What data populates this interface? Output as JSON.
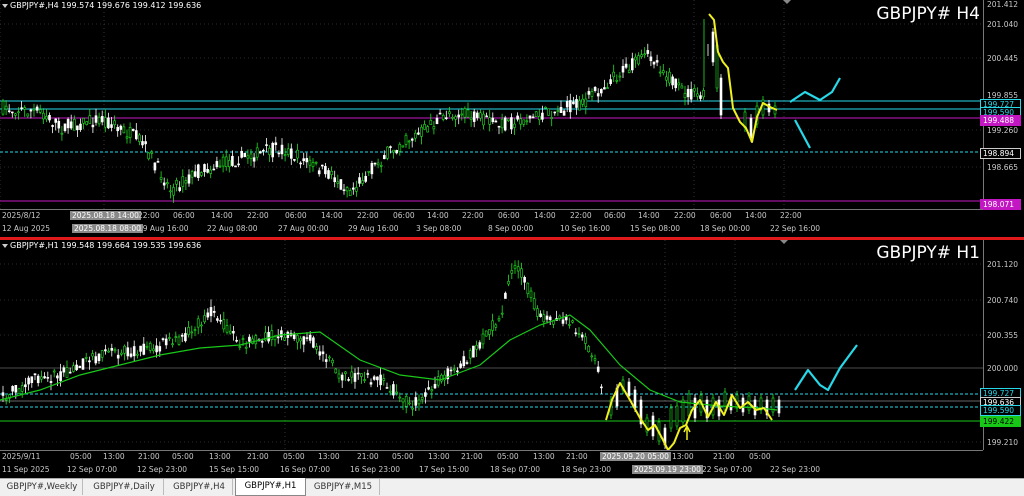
{
  "tabs": [
    {
      "label": "GBPJPY#,Weekly",
      "active": false
    },
    {
      "label": "GBPJPY#,Daily",
      "active": false
    },
    {
      "label": "GBPJPY#,H4",
      "active": false
    },
    {
      "label": "GBPJPY#,H1",
      "active": true
    },
    {
      "label": "GBPJPY#,M15",
      "active": false
    }
  ],
  "top": {
    "header": "GBPJPY#,H4  199.574 199.676 199.412 199.636",
    "title": "GBPJPY# H4",
    "price_ticks": [
      "201.412",
      "201.040",
      "200.445",
      "199.855",
      "199.260",
      "198.665"
    ],
    "price_labels": [
      {
        "text": "199.727",
        "bg": "#000000",
        "color": "#29d8e8",
        "border": "#29d8e8"
      },
      {
        "text": "199.590",
        "bg": "#000000",
        "color": "#29d8e8",
        "border": "#29d8e8"
      },
      {
        "text": "199.488",
        "bg": "#c417c4",
        "color": "#ffffff",
        "border": "#c417c4"
      },
      {
        "text": "198.894",
        "bg": "#000000",
        "color": "#ffffff",
        "border": "#cccccc"
      },
      {
        "text": "198.071",
        "bg": "#c417c4",
        "color": "#ffffff",
        "border": "#c417c4"
      }
    ],
    "time_row1": [
      "2025/8/12",
      "2025.08.18 14:00",
      "22:00",
      "06:00",
      "14:00",
      "22:00",
      "06:00",
      "14:00",
      "22:00",
      "06:00",
      "14:00",
      "22:00",
      "06:00",
      "14:00",
      "22:00",
      "06:00",
      "14:00",
      "22:00",
      "06:00",
      "14:00",
      "22:00"
    ],
    "time_row2": [
      "12 Aug 2025",
      "2025.08.18 08:00",
      "19 Aug 16:00",
      "22 Aug 08:00",
      "27 Aug 00:00",
      "29 Aug 16:00",
      "3 Sep 08:00",
      "8 Sep 00:00",
      "10 Sep 16:00",
      "15 Sep 08:00",
      "18 Sep 00:00",
      "22 Sep 16:00"
    ]
  },
  "bottom": {
    "header": "GBPJPY#,H1  199.548 199.664 199.535 199.636",
    "title": "GBPJPY# H1",
    "price_ticks": [
      "201.120",
      "200.740",
      "200.355",
      "200.000",
      "199.210"
    ],
    "price_labels": [
      {
        "text": "199.727",
        "bg": "#000000",
        "color": "#29d8e8",
        "border": "#29d8e8"
      },
      {
        "text": "199.636",
        "bg": "#000000",
        "color": "#ffffff",
        "border": "#cccccc"
      },
      {
        "text": "199.590",
        "bg": "#000000",
        "color": "#29d8e8",
        "border": "#29d8e8"
      },
      {
        "text": "199.422",
        "bg": "#17c817",
        "color": "#000000",
        "border": "#17c817"
      }
    ],
    "time_row1": [
      "2025/9/11",
      "05:00",
      "13:00",
      "21:00",
      "05:00",
      "13:00",
      "21:00",
      "05:00",
      "13:00",
      "21:00",
      "05:00",
      "13:00",
      "21:00",
      "05:00",
      "13:00",
      "21:00",
      "2025.09.20 05:00",
      "13:00",
      "21:00",
      "05:00"
    ],
    "time_row2": [
      "11 Sep 2025",
      "12 Sep 07:00",
      "12 Sep 23:00",
      "15 Sep 15:00",
      "16 Sep 07:00",
      "16 Sep 23:00",
      "17 Sep 15:00",
      "18 Sep 07:00",
      "18 Sep 23:00",
      "2025.09.19 23:00",
      "22 Sep 07:00",
      "22 Sep 23:00"
    ]
  },
  "colors": {
    "bull": "#22e022",
    "bear": "#ffffff",
    "cyan": "#29d8e8",
    "magenta": "#c417c4",
    "yellow": "#f0f020",
    "ma": "#19c819",
    "separator": "#e01a1a"
  }
}
